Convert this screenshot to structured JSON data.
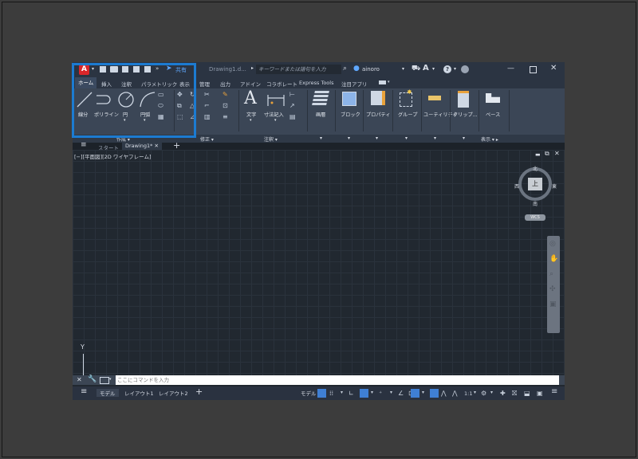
{
  "titlebar": {
    "app_letter": "A",
    "share_label": "共有",
    "doc_title": "Drawing1.d...",
    "search_placeholder": "キーワードまたは語句を入力",
    "user": "ainoro"
  },
  "ribbon_tabs": [
    "ホーム",
    "挿入",
    "注釈",
    "パラメトリック",
    "表示",
    "管理",
    "出力",
    "アドイン",
    "コラボレート",
    "Express Tools",
    "注目アプリ"
  ],
  "tools": {
    "line": "線分",
    "polyline": "ポリライン",
    "circle": "円",
    "arc": "円弧",
    "text": "文字",
    "dimension": "寸法記入",
    "layer": "画層",
    "block": "ブロック",
    "properties": "プロパティ",
    "group": "グループ",
    "utility": "ユーティリティ",
    "clipboard": "クリップ...",
    "base": "ベース"
  },
  "panels": {
    "draw": "作成",
    "modify": "修正",
    "annotation": "注釈",
    "view": "表示"
  },
  "file_tabs": {
    "start": "スタート",
    "drawing": "Drawing1*"
  },
  "viewport": {
    "label": "[−][平面図][2D ワイヤフレーム]",
    "compass": {
      "north": "北",
      "south": "南",
      "east": "東",
      "west": "西",
      "top": "上",
      "wcs": "WCS"
    },
    "y_axis": "Y"
  },
  "command": {
    "placeholder": "ここにコマンドを入力"
  },
  "status": {
    "model_tab": "モデル",
    "layout1": "レイアウト1",
    "layout2": "レイアウト2",
    "model_btn": "モデル",
    "scale": "1:1"
  },
  "colors": {
    "accent": "#3f7fd4",
    "highlight": "#1c7bd1",
    "app_red": "#d9262a"
  }
}
